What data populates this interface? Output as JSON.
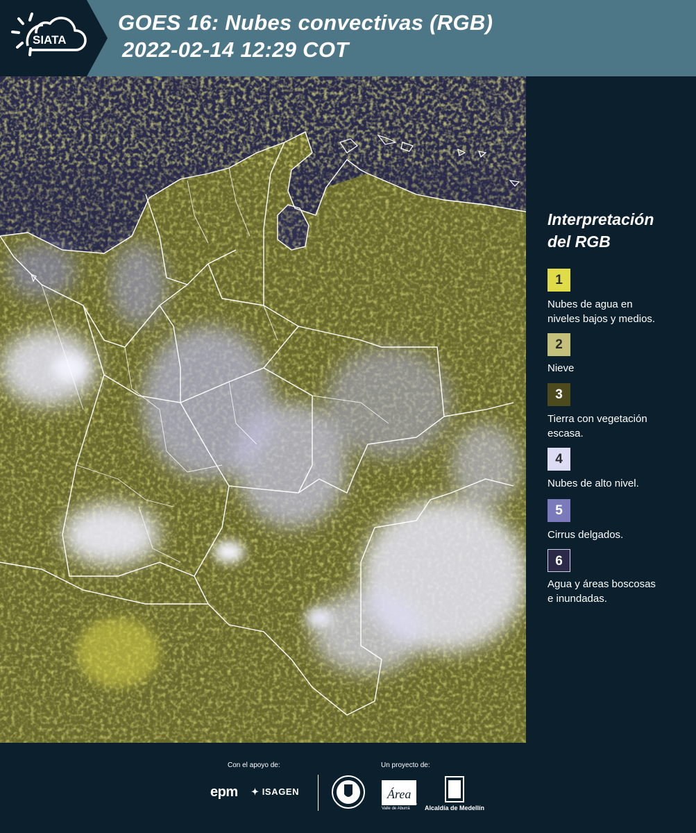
{
  "header": {
    "logo_text": "SIATA",
    "title_line1": "GOES 16: Nubes convectivas (RGB)",
    "title_line2": "2022-02-14 12:29 COT"
  },
  "legend": {
    "title_line1": "Interpretación",
    "title_line2": "del RGB",
    "items": [
      {
        "number": "1",
        "label_line1": "Nubes de agua en",
        "label_line2": "niveles bajos y medios.",
        "color": "#e0db48"
      },
      {
        "number": "2",
        "label_line1": "Nieve",
        "label_line2": "",
        "color": "#c2c07a"
      },
      {
        "number": "3",
        "label_line1": "Tierra con vegetación",
        "label_line2": "escasa.",
        "color": "#4d4b1e"
      },
      {
        "number": "4",
        "label_line1": "Nubes de alto nivel.",
        "label_line2": "",
        "color": "#dcdcf4"
      },
      {
        "number": "5",
        "label_line1": "Cirrus delgados.",
        "label_line2": "",
        "color": "#7b7bbb"
      },
      {
        "number": "6",
        "label_line1": "Agua y áreas boscosas",
        "label_line2": "e inundadas.",
        "color": "#2a2a48"
      }
    ]
  },
  "footer": {
    "support_label": "Con el apoyo de:",
    "project_label": "Un proyecto de:",
    "epm": "epm",
    "isagen": "ISAGEN",
    "area_name_line1": "METROPOLITANA",
    "area_name_line2": "Valle de Aburrá",
    "area_script": "Área",
    "alcaldia": "Alcaldía de Medellín"
  },
  "colors": {
    "header_bg": "#4d7687",
    "panel_bg": "#0c1f2d",
    "land_yellow": "#c9c63c",
    "cloud_white": "#e7e7f7",
    "ocean": "#2a2b4b"
  }
}
